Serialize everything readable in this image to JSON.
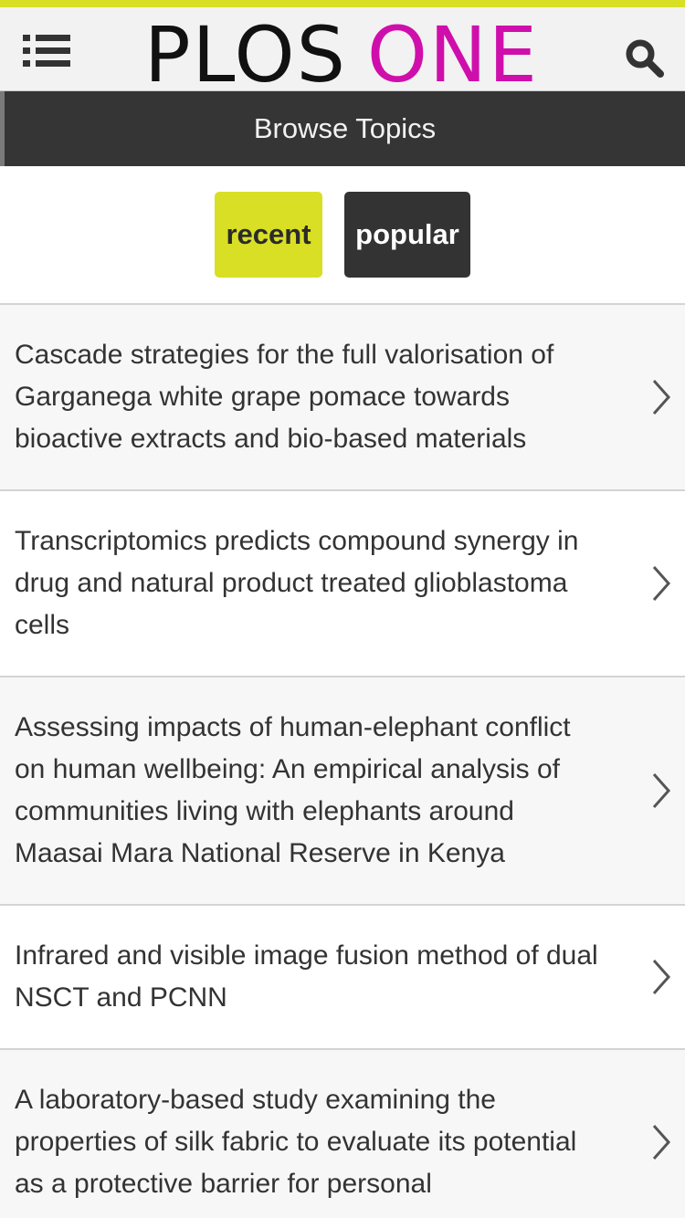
{
  "header": {
    "logo_part1": "PLOS",
    "logo_part2": "ONE",
    "menu_icon": "list-menu-icon",
    "search_icon": "search-icon",
    "accent_color": "#d8df25",
    "brand_color": "#cf0fab"
  },
  "browse": {
    "title": "Browse Topics"
  },
  "toggle": {
    "recent_label": "recent",
    "popular_label": "popular",
    "selected": "recent"
  },
  "articles": [
    {
      "title": "Cascade strategies for the full valorisation of Garganega white grape pomace towards bioactive extracts and bio-based materials"
    },
    {
      "title": "Transcriptomics predicts compound synergy in drug and natural product treated glioblastoma cells"
    },
    {
      "title": "Assessing impacts of human-elephant conflict on human wellbeing: An empirical analysis of communities living with elephants around Maasai Mara National Reserve in Kenya"
    },
    {
      "title": "Infrared and visible image fusion method of dual NSCT and PCNN"
    },
    {
      "title": "A laboratory-based study examining the properties of silk fabric to evaluate its potential as a protective barrier for personal"
    }
  ]
}
